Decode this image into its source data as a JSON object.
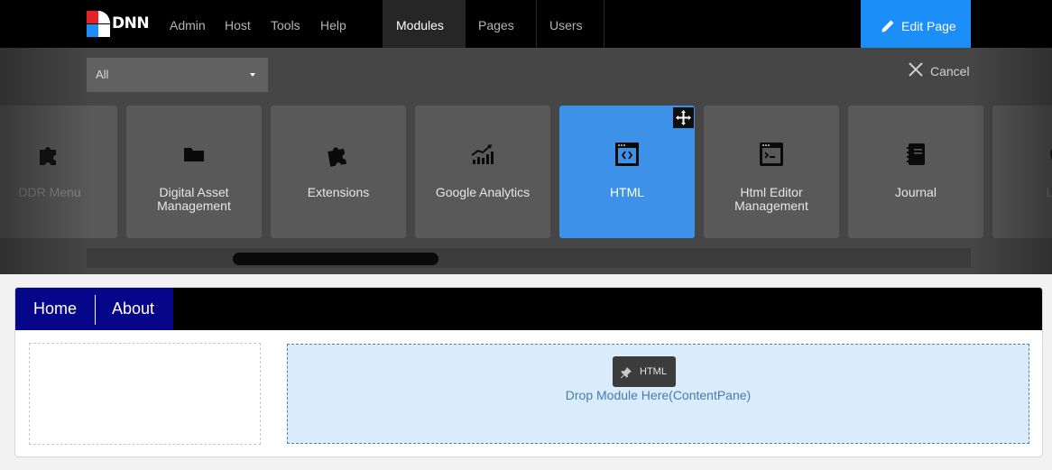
{
  "topbar": {
    "logo_text": "DNN",
    "links": [
      "Admin",
      "Host",
      "Tools",
      "Help"
    ],
    "dropdowns": [
      "Modules",
      "Pages",
      "Users"
    ],
    "edit_page_label": "Edit Page",
    "colors": {
      "background": "#000000",
      "accent": "#1b8ef7"
    }
  },
  "module_panel": {
    "filter_value": "All",
    "cancel_label": "Cancel",
    "modules": [
      {
        "label": "DDR Menu",
        "icon": "puzzle-icon",
        "state": "partial"
      },
      {
        "label": "Digital Asset Management",
        "icon": "folder-icon",
        "state": "normal"
      },
      {
        "label": "Extensions",
        "icon": "puzzle-icon",
        "state": "normal"
      },
      {
        "label": "Google Analytics",
        "icon": "chart-trend-icon",
        "state": "normal"
      },
      {
        "label": "HTML",
        "icon": "code-window-icon",
        "state": "selected"
      },
      {
        "label": "Html Editor Management",
        "icon": "terminal-window-icon",
        "state": "normal"
      },
      {
        "label": "Journal",
        "icon": "notebook-icon",
        "state": "normal"
      },
      {
        "label": "Lang",
        "icon": "globe-icon",
        "state": "partial"
      }
    ],
    "selected_color": "#3d92e8"
  },
  "page": {
    "menu": [
      "Home",
      "About"
    ],
    "menu_color": "#060688",
    "drop_text": "Drop Module Here(ContentPane)",
    "drag_badge_label": "HTML"
  }
}
